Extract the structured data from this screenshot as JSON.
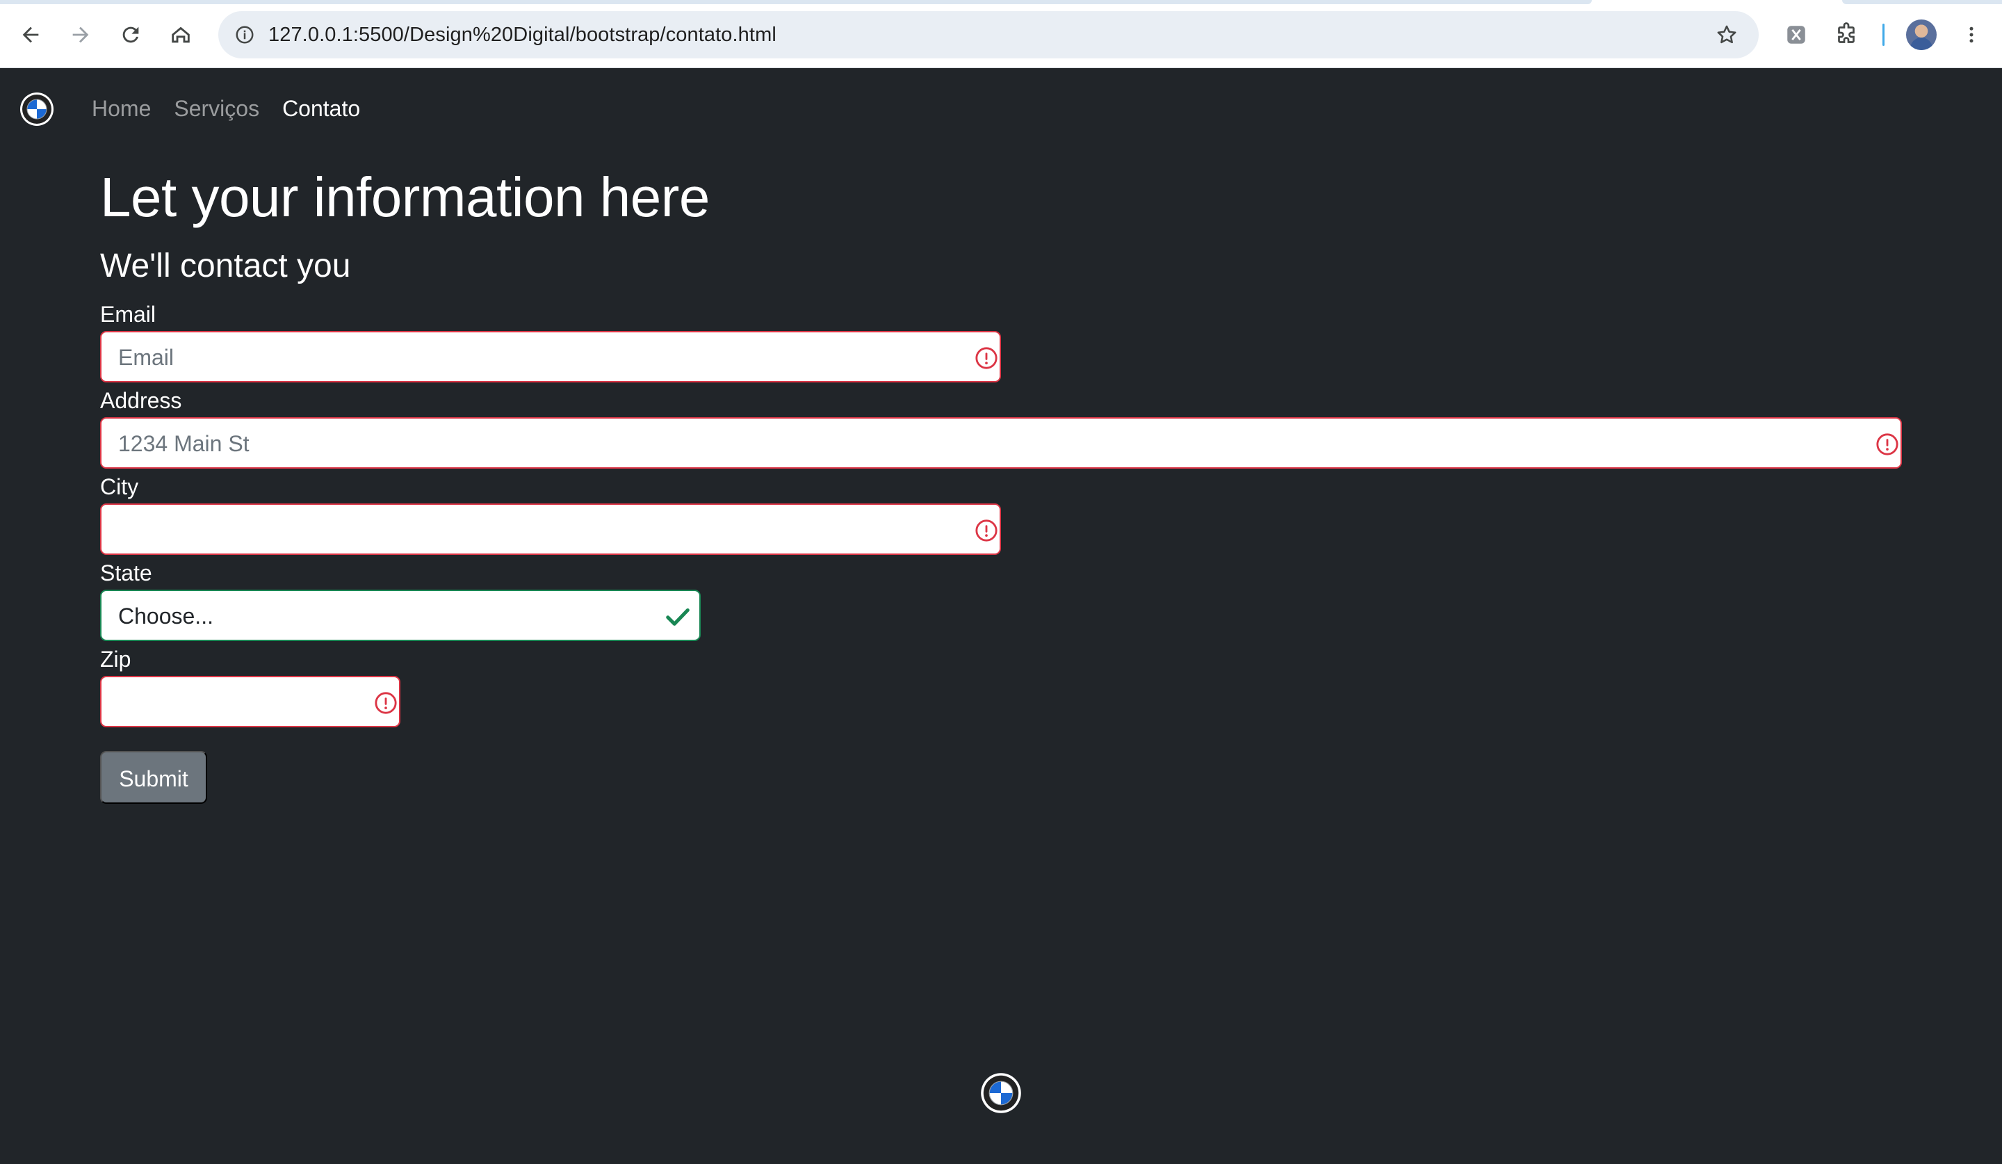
{
  "browser": {
    "url": "127.0.0.1:5500/Design%20Digital/bootstrap/contato.html"
  },
  "navbar": {
    "brand_icon": "bmw-logo-icon",
    "links": [
      {
        "label": "Home",
        "active": false
      },
      {
        "label": "Serviços",
        "active": false
      },
      {
        "label": "Contato",
        "active": true
      }
    ]
  },
  "page": {
    "title": "Let your information here",
    "subtitle": "We'll contact you"
  },
  "form": {
    "email": {
      "label": "Email",
      "placeholder": "Email",
      "value": "",
      "state": "invalid"
    },
    "address": {
      "label": "Address",
      "placeholder": "1234 Main St",
      "value": "",
      "state": "invalid"
    },
    "city": {
      "label": "City",
      "placeholder": "",
      "value": "",
      "state": "invalid"
    },
    "state": {
      "label": "State",
      "selected": "Choose...",
      "state": "valid"
    },
    "zip": {
      "label": "Zip",
      "placeholder": "",
      "value": "",
      "state": "invalid"
    },
    "submit_label": "Submit"
  },
  "colors": {
    "page_bg": "#212529",
    "invalid": "#dc3545",
    "valid": "#198754",
    "button": "#6c757d"
  },
  "footer": {
    "logo_icon": "bmw-logo-icon"
  }
}
